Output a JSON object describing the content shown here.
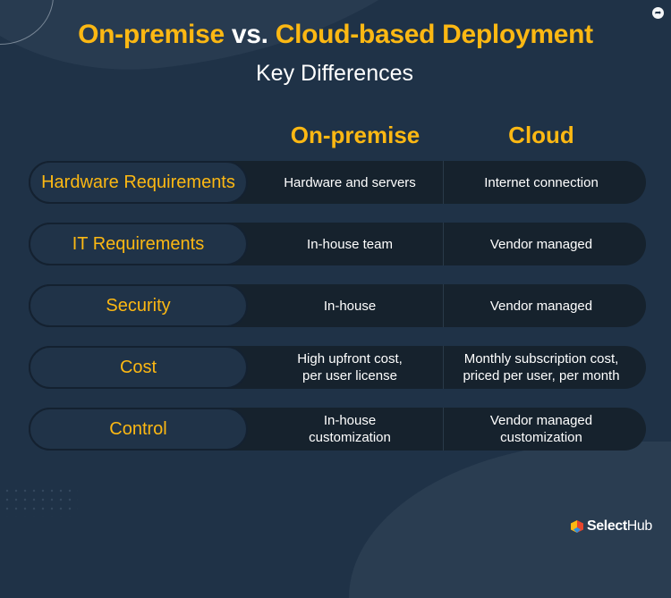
{
  "header": {
    "title_part1": "On-premise",
    "title_vs": "vs.",
    "title_part2": "Cloud-based Deployment",
    "subtitle": "Key Differences"
  },
  "columns": {
    "onprem": "On-premise",
    "cloud": "Cloud"
  },
  "rows": [
    {
      "label": "Hardware Requirements",
      "onprem": [
        "Hardware and servers"
      ],
      "cloud": [
        "Internet connection"
      ]
    },
    {
      "label": "IT Requirements",
      "onprem": [
        "In-house team"
      ],
      "cloud": [
        "Vendor managed"
      ]
    },
    {
      "label": "Security",
      "onprem": [
        "In-house"
      ],
      "cloud": [
        "Vendor managed"
      ]
    },
    {
      "label": "Cost",
      "onprem": [
        "High upfront cost,",
        "per user license"
      ],
      "cloud": [
        "Monthly subscription cost,",
        "priced per user, per month"
      ]
    },
    {
      "label": "Control",
      "onprem": [
        "In-house",
        "customization"
      ],
      "cloud": [
        "Vendor managed",
        "customization"
      ]
    }
  ],
  "brand": {
    "name_bold": "Select",
    "name_regular": "Hub"
  },
  "icons": {
    "share": "share-arrow-icon",
    "logo": "selecthub-cube-icon"
  },
  "colors": {
    "background": "#1f3247",
    "accent": "#fcb813",
    "row_bar": "#16222d",
    "label_pill": "#203348",
    "text": "#ffffff"
  }
}
